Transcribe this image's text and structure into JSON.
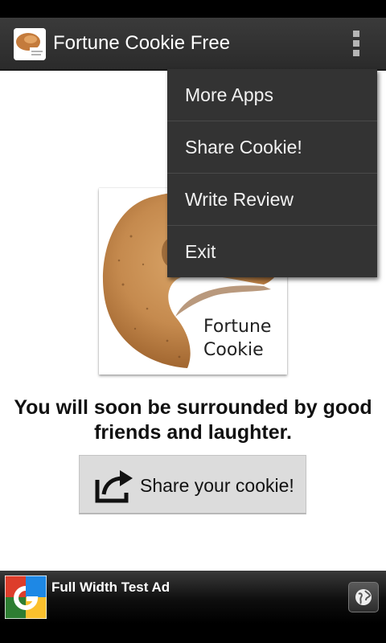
{
  "app": {
    "title": "Fortune Cookie Free",
    "icon": "fortune-cookie-app-icon"
  },
  "menu": {
    "items": [
      {
        "label": "More Apps"
      },
      {
        "label": "Share Cookie!"
      },
      {
        "label": "Write Review"
      },
      {
        "label": "Exit"
      }
    ]
  },
  "cookie": {
    "label_line1": "Fortune",
    "label_line2": "Cookie"
  },
  "fortune": {
    "text": "You will soon be surrounded by good friends and laughter."
  },
  "share": {
    "label": "Share your cookie!",
    "icon": "share-icon"
  },
  "ad": {
    "title": "Full Width Test Ad",
    "icon": "google-logo",
    "action_icon": "globe-icon"
  },
  "colors": {
    "action_bar": "#2f2f2f",
    "menu_bg": "#333333",
    "share_button": "#dcdcdc",
    "cookie": "#c88a4a"
  }
}
